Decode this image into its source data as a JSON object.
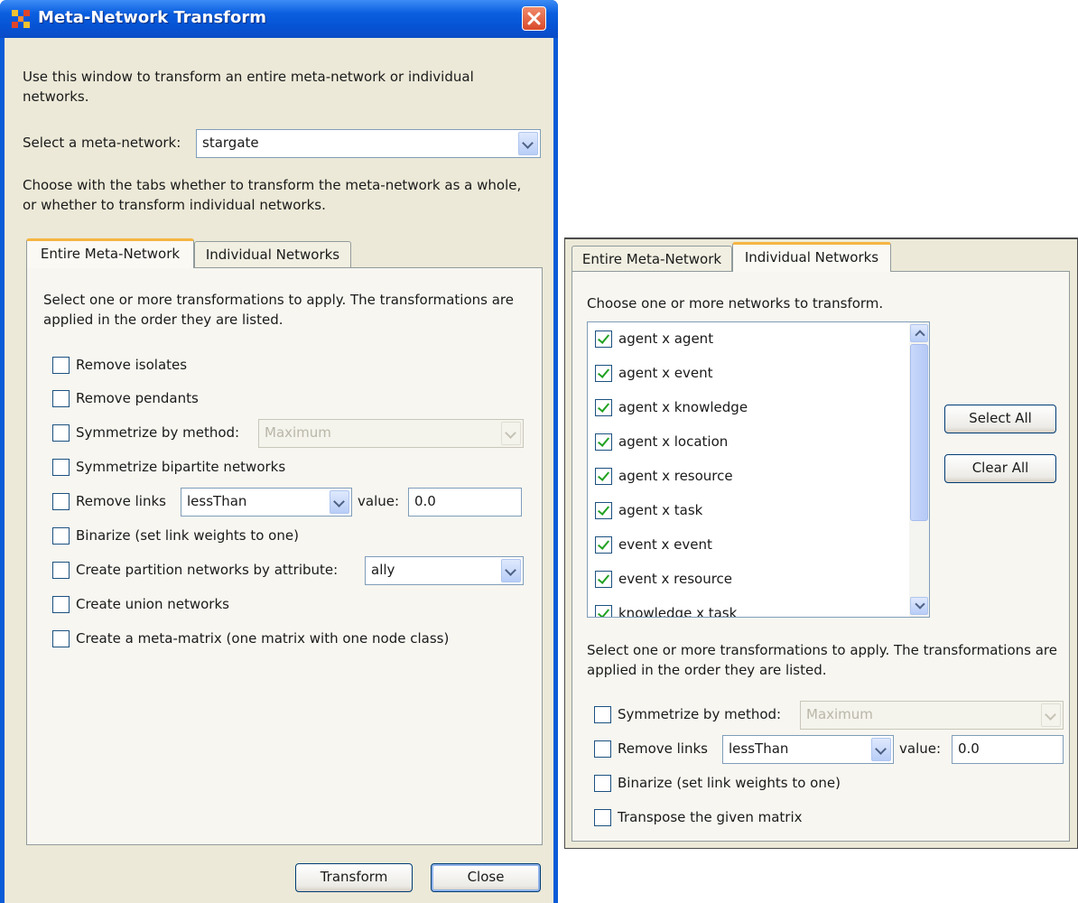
{
  "window": {
    "title": "Meta-Network Transform",
    "intro": "Use this window to transform an entire meta-network or individual networks.",
    "select_label": "Select a meta-network:",
    "select_value": "stargate",
    "tabs_intro": "Choose with the tabs whether to transform the meta-network as a whole, or whether to transform individual networks.",
    "tabs": [
      "Entire Meta-Network",
      "Individual Networks"
    ],
    "panel_intro": "Select one or more transformations to apply. The transformations are applied in the order they are listed.",
    "options": {
      "remove_isolates": "Remove isolates",
      "remove_pendants": "Remove pendants",
      "symmetrize_label": "Symmetrize by method:",
      "symmetrize_value": "Maximum",
      "symmetrize_bipartite": "Symmetrize bipartite networks",
      "remove_links_label": "Remove links",
      "remove_links_value": "lessThan",
      "value_label": "value:",
      "value_input": "0.0",
      "binarize": "Binarize (set link weights to one)",
      "partition_label": "Create partition networks by attribute:",
      "partition_value": "ally",
      "union": "Create union networks",
      "meta_matrix": "Create a meta-matrix (one matrix with one node class)"
    },
    "buttons": {
      "transform": "Transform",
      "close": "Close"
    }
  },
  "right_panel": {
    "tabs": [
      "Entire Meta-Network",
      "Individual Networks"
    ],
    "choose_label": "Choose one or more networks to transform.",
    "networks": [
      "agent x agent",
      "agent x event",
      "agent x knowledge",
      "agent x location",
      "agent x resource",
      "agent x task",
      "event x event",
      "event x resource",
      "knowledge x task"
    ],
    "select_all": "Select All",
    "clear_all": "Clear All",
    "panel_intro": "Select one or more transformations to apply. The transformations are applied in the order they are listed.",
    "options": {
      "symmetrize_label": "Symmetrize by method:",
      "symmetrize_value": "Maximum",
      "remove_links_label": "Remove links",
      "remove_links_value": "lessThan",
      "value_label": "value:",
      "value_input": "0.0",
      "binarize": "Binarize (set link weights to one)",
      "transpose": "Transpose the given matrix"
    }
  }
}
